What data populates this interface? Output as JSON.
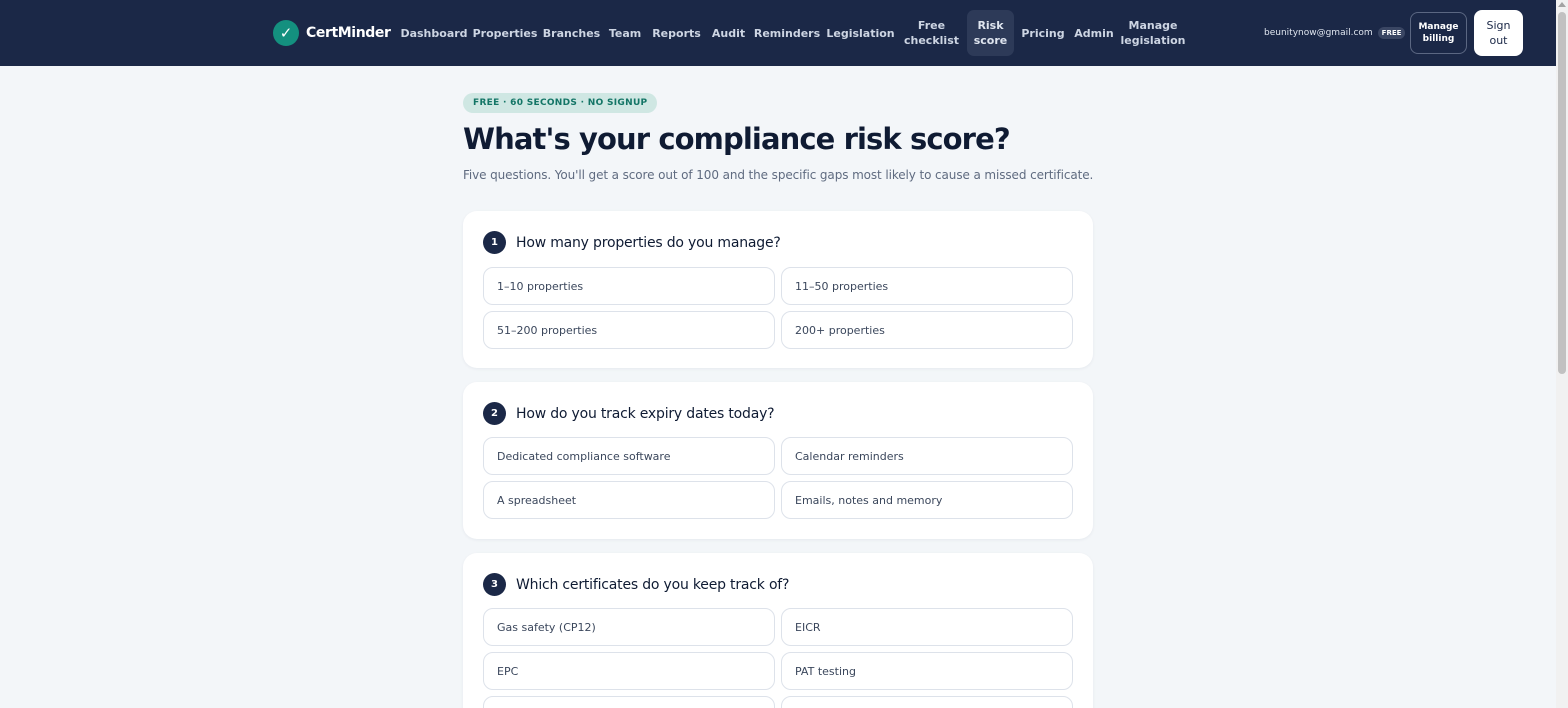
{
  "nav": {
    "brand": "CertMinder",
    "logo_glyph": "✓",
    "links": [
      {
        "label": "Dashboard"
      },
      {
        "label": "Properties"
      },
      {
        "label": "Branches"
      },
      {
        "label": "Team"
      },
      {
        "label": "Reports"
      },
      {
        "label": "Audit"
      },
      {
        "label": "Reminders"
      },
      {
        "label": "Legislation"
      },
      {
        "label": "Free\nchecklist"
      },
      {
        "label": "Risk\nscore"
      },
      {
        "label": "Pricing"
      },
      {
        "label": "Admin"
      },
      {
        "label": "Manage\nlegislation"
      }
    ],
    "email": "beunitynow@gmail.com",
    "plan": "FREE",
    "manage_billing": "Manage\nbilling",
    "sign_out": "Sign\nout"
  },
  "hero": {
    "pill": "FREE · 60 SECONDS · NO SIGNUP",
    "title": "What's your compliance risk score?",
    "subtitle": "Five questions. You'll get a score out of 100 and the specific gaps most likely to cause a missed certificate."
  },
  "questions": [
    {
      "number": "1",
      "text": "How many properties do you manage?",
      "options": [
        "1–10 properties",
        "11–50 properties",
        "51–200 properties",
        "200+ properties"
      ]
    },
    {
      "number": "2",
      "text": "How do you track expiry dates today?",
      "options": [
        "Dedicated compliance software",
        "Calendar reminders",
        "A spreadsheet",
        "Emails, notes and memory"
      ]
    },
    {
      "number": "3",
      "text": "Which certificates do you keep track of?",
      "options": [
        "Gas safety (CP12)",
        "EICR",
        "EPC",
        "PAT testing"
      ]
    }
  ],
  "colors": {
    "nav_bg": "#1b2847",
    "accent": "#14907f",
    "page_bg": "#f3f6f9"
  }
}
